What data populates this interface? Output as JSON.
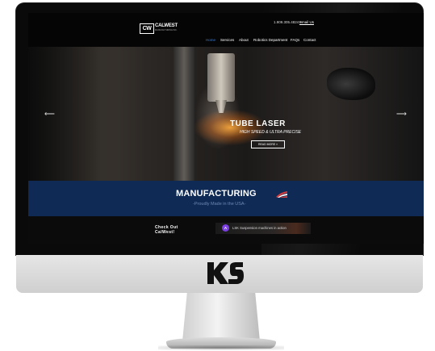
{
  "site": {
    "phone": "1.909.305.4824 –",
    "email_label": "Email Us",
    "logo_mark": "CW",
    "logo_name": "CALWEST",
    "logo_tagline": "MANUFACTURING INC."
  },
  "nav": {
    "items": [
      {
        "label": "Home",
        "active": true
      },
      {
        "label": "Services"
      },
      {
        "label": "About"
      },
      {
        "label": "Robotics Department"
      },
      {
        "label": "FAQs"
      },
      {
        "label": "Contact"
      }
    ]
  },
  "hero": {
    "title": "TUBE LASER",
    "subtitle": "HIGH SPEED & ULTRA PRECISE",
    "button_label": "READ MORE »",
    "prev_arrow": "⟵",
    "next_arrow": "⟶"
  },
  "banner": {
    "title": "MANUFACTURING",
    "subtitle": "-Proudly Made in the USA-"
  },
  "promo": {
    "heading_line1": "Check Out",
    "heading_line2": "CalWest!",
    "video_icon_letter": "A",
    "video_title": "LSK Suspension machines in action"
  },
  "monitor": {
    "badge_logo": "KS"
  },
  "colors": {
    "nav_active": "#3a7bd5",
    "banner_bg": "#0e2a55",
    "video_icon": "#7b3fe4"
  }
}
